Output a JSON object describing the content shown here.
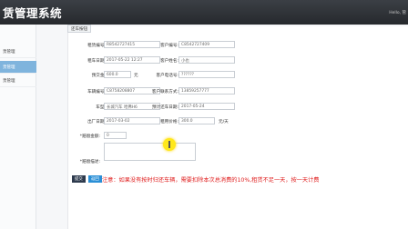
{
  "header": {
    "title": "赁管理系统",
    "greeting": "Hello, 管"
  },
  "sidebar": {
    "items": [
      {
        "label": "赁管理"
      },
      {
        "label": "赁管理"
      },
      {
        "label": "赁管理"
      }
    ]
  },
  "tab": {
    "label": "还车按钮"
  },
  "form": {
    "rent_order_no": {
      "label": "租赁编号:",
      "value": "R8542727415"
    },
    "customer_no": {
      "label": "客户编号:",
      "value": "C8542727409"
    },
    "rent_date": {
      "label": "租车日期:",
      "value": "2017-05-22 12:27"
    },
    "customer_name": {
      "label": "客户姓名:",
      "value": "小也"
    },
    "deposit": {
      "label": "预交金:",
      "value": "600.0",
      "unit": "元"
    },
    "customer_phone": {
      "label": "客户电话号:",
      "value": "??????"
    },
    "car_no": {
      "label": "车辆编号:",
      "value": "C8758208807"
    },
    "customer_contact": {
      "label": "客户联系方式:",
      "value": "13859257777"
    },
    "car_model": {
      "label": "车型:",
      "value": "长城汽车 哈弗H6"
    },
    "expected_return": {
      "label": "预计还车日期:",
      "value": "2017-05-24"
    },
    "plan_time": {
      "label": "出厂日期:",
      "value": "2017-03-02"
    },
    "daily_price": {
      "label": "租用价格:",
      "value": "300.0",
      "unit": "元/天"
    },
    "penalty": {
      "label": "*赔偿金额:",
      "value": "0"
    },
    "remark": {
      "label": "*赔偿描述:",
      "value": ""
    }
  },
  "buttons": {
    "save": "提交",
    "back": "返回"
  },
  "notice": "注意：如果没有按时归还车辆，需要扣除本次总消费的10%,租赁不足一天，按一天计费",
  "colors": {
    "notice": "#e02020",
    "active_sidebar": "#7fb4dd",
    "back_button": "#2a8fd6"
  }
}
